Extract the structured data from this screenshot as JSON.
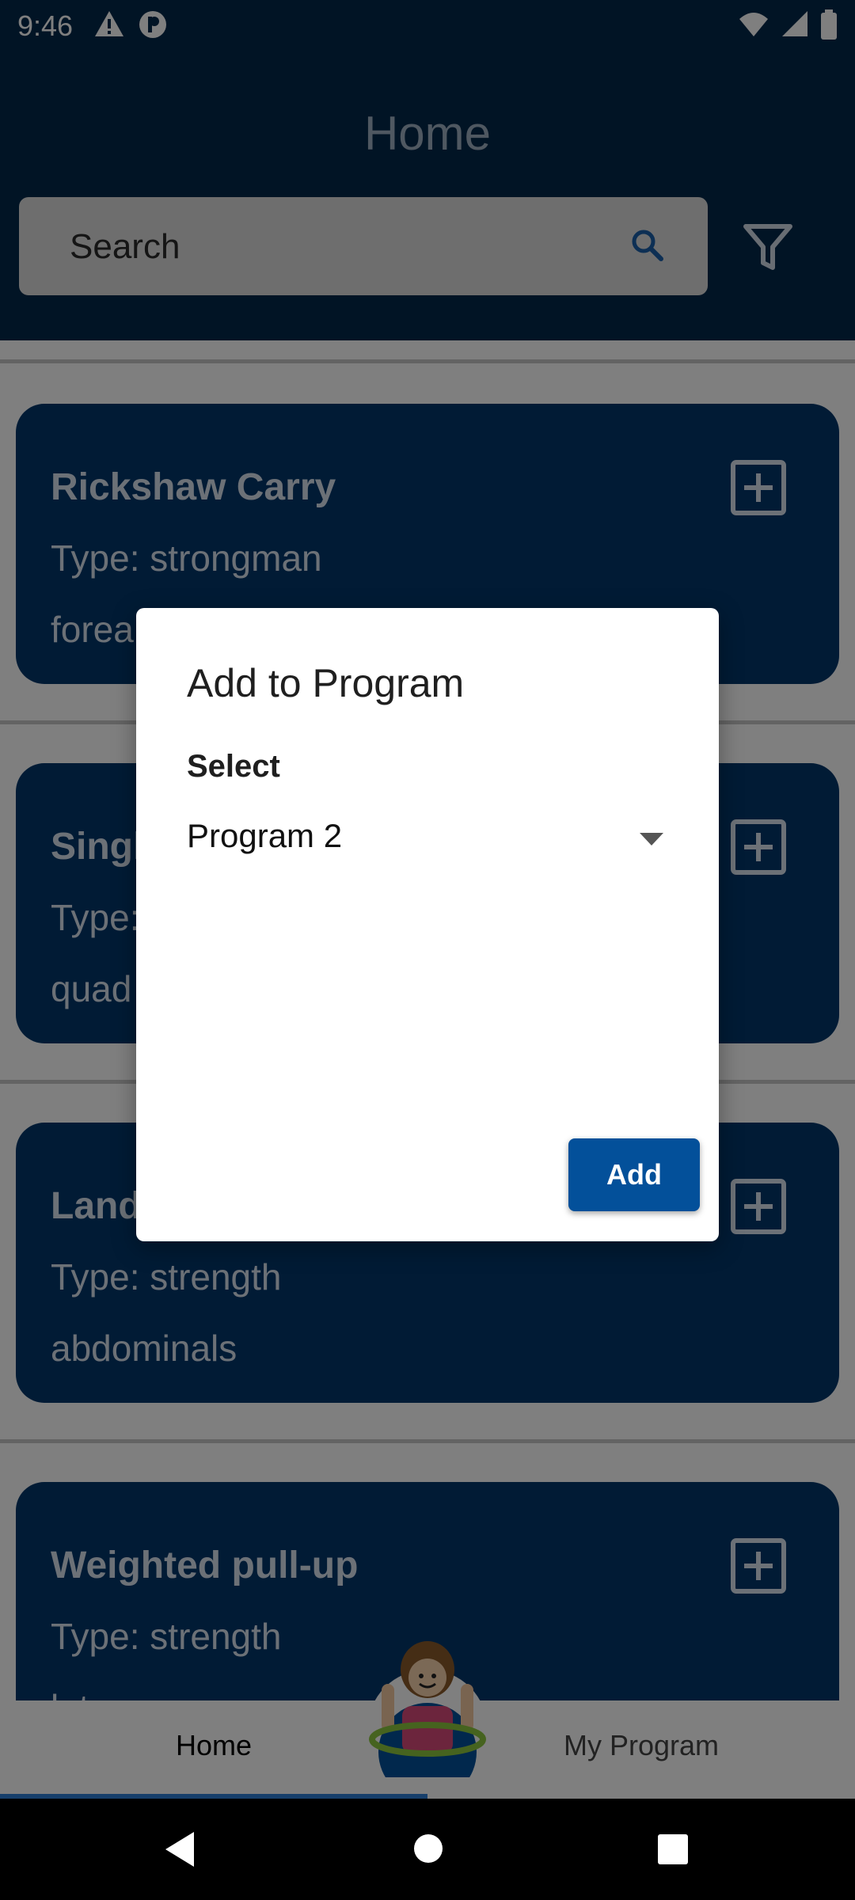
{
  "status_bar": {
    "time": "9:46",
    "left_icons": [
      "warning-icon",
      "p-circle-icon"
    ],
    "right_icons": [
      "wifi-icon",
      "cell-signal-icon",
      "battery-icon"
    ]
  },
  "header": {
    "title": "Home",
    "search_placeholder": "Search"
  },
  "cards": [
    {
      "title": "Rickshaw Carry",
      "type": "Type: strongman",
      "muscle": "forea"
    },
    {
      "title": "Singl",
      "type": "Type:",
      "muscle": "quad"
    },
    {
      "title": "Land",
      "type": "Type: strength",
      "muscle": "abdominals"
    },
    {
      "title": "Weighted pull-up",
      "type": "Type: strength",
      "muscle": "lat"
    }
  ],
  "bottom_nav": {
    "home_label": "Home",
    "program_label": "My Program"
  },
  "dialog": {
    "title": "Add to Program",
    "select_label": "Select",
    "selected_program": "Program 2",
    "add_label": "Add"
  },
  "colors": {
    "header_bg": "#03294a",
    "card_bg": "#03376b",
    "button_bg": "#03509a"
  }
}
